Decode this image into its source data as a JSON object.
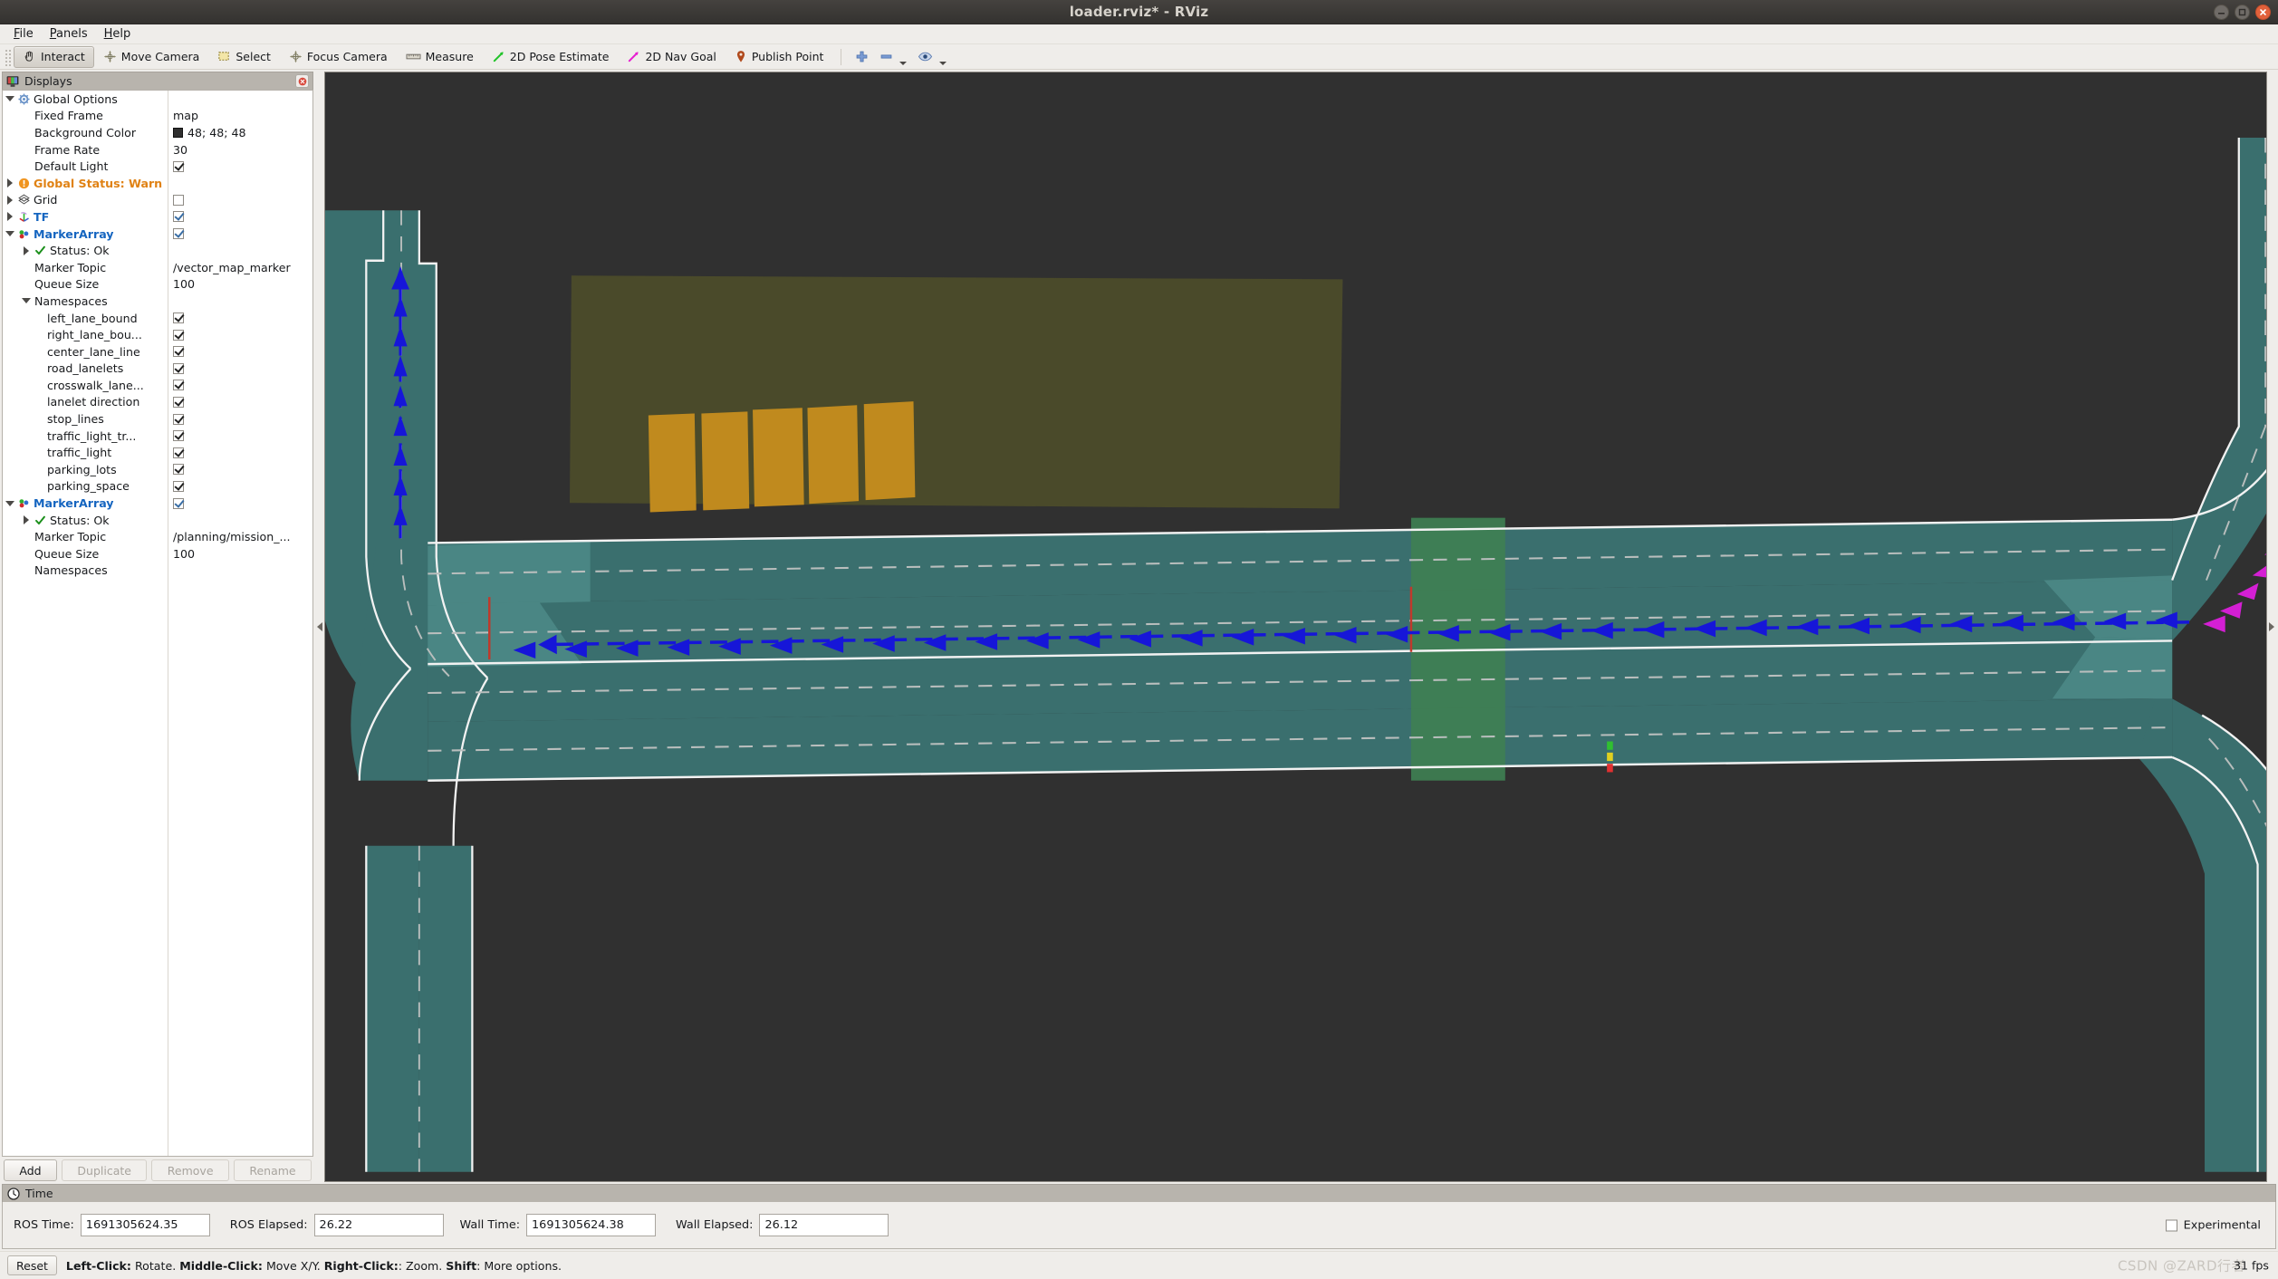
{
  "window": {
    "title": "loader.rviz* - RViz",
    "controls": [
      "minimize",
      "maximize",
      "close"
    ]
  },
  "menubar": {
    "items": [
      {
        "label": "File",
        "mnemonic": "F"
      },
      {
        "label": "Panels",
        "mnemonic": "P"
      },
      {
        "label": "Help",
        "mnemonic": "H"
      }
    ]
  },
  "toolbar": {
    "tools": [
      {
        "label": "Interact",
        "icon": "hand-cursor-icon",
        "active": true
      },
      {
        "label": "Move Camera",
        "icon": "move-camera-icon",
        "active": false
      },
      {
        "label": "Select",
        "icon": "select-rect-icon",
        "active": false
      },
      {
        "label": "Focus Camera",
        "icon": "focus-camera-icon",
        "active": false
      },
      {
        "label": "Measure",
        "icon": "ruler-icon",
        "active": false
      },
      {
        "label": "2D Pose Estimate",
        "icon": "pose-arrow-icon",
        "active": false
      },
      {
        "label": "2D Nav Goal",
        "icon": "nav-goal-arrow-icon",
        "active": false
      },
      {
        "label": "Publish Point",
        "icon": "map-pin-icon",
        "active": false
      }
    ],
    "extra": [
      {
        "icon": "plus-icon",
        "label": ""
      },
      {
        "icon": "minus-icon",
        "label": ""
      },
      {
        "icon": "eye-icon",
        "label": ""
      }
    ]
  },
  "displays_panel": {
    "header": "Displays",
    "close_icon": "close-panel-icon",
    "rows": [
      {
        "level": 0,
        "twisty": "open",
        "icon": "gear-icon",
        "label": "Global Options",
        "style": "plain",
        "value": "",
        "value_type": "none"
      },
      {
        "level": 1,
        "twisty": "none",
        "icon": "none",
        "label": "Fixed Frame",
        "style": "plain",
        "value": "map",
        "value_type": "text"
      },
      {
        "level": 1,
        "twisty": "none",
        "icon": "none",
        "label": "Background Color",
        "style": "plain",
        "value": "48; 48; 48",
        "value_type": "color"
      },
      {
        "level": 1,
        "twisty": "none",
        "icon": "none",
        "label": "Frame Rate",
        "style": "plain",
        "value": "30",
        "value_type": "text"
      },
      {
        "level": 1,
        "twisty": "none",
        "icon": "none",
        "label": "Default Light",
        "style": "plain",
        "value": "",
        "value_type": "checked-dark"
      },
      {
        "level": 0,
        "twisty": "closed",
        "icon": "warn-icon",
        "label": "Global Status: Warn",
        "style": "warn",
        "value": "",
        "value_type": "none"
      },
      {
        "level": 0,
        "twisty": "closed",
        "icon": "grid-icon",
        "label": "Grid",
        "style": "plain",
        "value": "",
        "value_type": "unchecked"
      },
      {
        "level": 0,
        "twisty": "closed",
        "icon": "tf-axes-icon",
        "label": "TF",
        "style": "blue",
        "value": "",
        "value_type": "checked"
      },
      {
        "level": 0,
        "twisty": "open",
        "icon": "marker-array-icon",
        "label": "MarkerArray",
        "style": "blue",
        "value": "",
        "value_type": "checked"
      },
      {
        "level": 1,
        "twisty": "closed",
        "icon": "check-ok-icon",
        "label": "Status: Ok",
        "style": "plain",
        "value": "",
        "value_type": "none"
      },
      {
        "level": 1,
        "twisty": "none",
        "icon": "none",
        "label": "Marker Topic",
        "style": "plain",
        "value": "/vector_map_marker",
        "value_type": "text"
      },
      {
        "level": 1,
        "twisty": "none",
        "icon": "none",
        "label": "Queue Size",
        "style": "plain",
        "value": "100",
        "value_type": "text"
      },
      {
        "level": 1,
        "twisty": "open",
        "icon": "none",
        "label": "Namespaces",
        "style": "plain",
        "value": "",
        "value_type": "none"
      },
      {
        "level": 2,
        "twisty": "none",
        "icon": "none",
        "label": "left_lane_bound",
        "style": "plain",
        "value": "",
        "value_type": "checked-dark"
      },
      {
        "level": 2,
        "twisty": "none",
        "icon": "none",
        "label": "right_lane_bou...",
        "style": "plain",
        "value": "",
        "value_type": "checked-dark"
      },
      {
        "level": 2,
        "twisty": "none",
        "icon": "none",
        "label": "center_lane_line",
        "style": "plain",
        "value": "",
        "value_type": "checked-dark"
      },
      {
        "level": 2,
        "twisty": "none",
        "icon": "none",
        "label": "road_lanelets",
        "style": "plain",
        "value": "",
        "value_type": "checked-dark"
      },
      {
        "level": 2,
        "twisty": "none",
        "icon": "none",
        "label": "crosswalk_lane...",
        "style": "plain",
        "value": "",
        "value_type": "checked-dark"
      },
      {
        "level": 2,
        "twisty": "none",
        "icon": "none",
        "label": "lanelet direction",
        "style": "plain",
        "value": "",
        "value_type": "checked-dark"
      },
      {
        "level": 2,
        "twisty": "none",
        "icon": "none",
        "label": "stop_lines",
        "style": "plain",
        "value": "",
        "value_type": "checked-dark"
      },
      {
        "level": 2,
        "twisty": "none",
        "icon": "none",
        "label": "traffic_light_tr...",
        "style": "plain",
        "value": "",
        "value_type": "checked-dark"
      },
      {
        "level": 2,
        "twisty": "none",
        "icon": "none",
        "label": "traffic_light",
        "style": "plain",
        "value": "",
        "value_type": "checked-dark"
      },
      {
        "level": 2,
        "twisty": "none",
        "icon": "none",
        "label": "parking_lots",
        "style": "plain",
        "value": "",
        "value_type": "checked-dark"
      },
      {
        "level": 2,
        "twisty": "none",
        "icon": "none",
        "label": "parking_space",
        "style": "plain",
        "value": "",
        "value_type": "checked-dark"
      },
      {
        "level": 0,
        "twisty": "open",
        "icon": "marker-array-icon",
        "label": "MarkerArray",
        "style": "blue",
        "value": "",
        "value_type": "checked"
      },
      {
        "level": 1,
        "twisty": "closed",
        "icon": "check-ok-icon",
        "label": "Status: Ok",
        "style": "plain",
        "value": "",
        "value_type": "none"
      },
      {
        "level": 1,
        "twisty": "none",
        "icon": "none",
        "label": "Marker Topic",
        "style": "plain",
        "value": "/planning/mission_...",
        "value_type": "text"
      },
      {
        "level": 1,
        "twisty": "none",
        "icon": "none",
        "label": "Queue Size",
        "style": "plain",
        "value": "100",
        "value_type": "text"
      },
      {
        "level": 1,
        "twisty": "none",
        "icon": "none",
        "label": "Namespaces",
        "style": "plain",
        "value": "",
        "value_type": "none"
      }
    ],
    "buttons": [
      {
        "label": "Add",
        "enabled": true
      },
      {
        "label": "Duplicate",
        "enabled": false
      },
      {
        "label": "Remove",
        "enabled": false
      },
      {
        "label": "Rename",
        "enabled": false
      }
    ]
  },
  "time_panel": {
    "header": "Time",
    "header_icon": "clock-icon",
    "fields": [
      {
        "label": "ROS Time:",
        "value": "1691305624.35"
      },
      {
        "label": "ROS Elapsed:",
        "value": "26.22"
      },
      {
        "label": "Wall Time:",
        "value": "1691305624.38"
      },
      {
        "label": "Wall Elapsed:",
        "value": "26.12"
      }
    ],
    "experimental": {
      "label": "Experimental",
      "checked": false
    }
  },
  "statusbar": {
    "reset_label": "Reset",
    "hint_parts": [
      {
        "text": "Left-Click:",
        "bold": true
      },
      {
        "text": " Rotate. ",
        "bold": false
      },
      {
        "text": "Middle-Click:",
        "bold": true
      },
      {
        "text": " Move X/Y. ",
        "bold": false
      },
      {
        "text": "Right-Click:",
        "bold": true
      },
      {
        "text": ": Zoom. ",
        "bold": false
      },
      {
        "text": "Shift",
        "bold": true
      },
      {
        "text": ": More options.",
        "bold": false
      }
    ],
    "fps": "31 fps",
    "watermark": "CSDN @ZARD行者"
  },
  "viewport": {
    "background_color": "#303030",
    "colors": {
      "road_lanelet": "#3a6f6e",
      "road_lanelet_overlap": "#4d8b88",
      "lane_bound": "#f2f2f2",
      "center_line": "#b9bebd",
      "crosswalk": "#3f7f52",
      "stop_line": "#c0392b",
      "lanelet_direction": "#1616d8",
      "mission_route": "#d41fd4",
      "parking_lot": "#4a4a2a",
      "parking_space": "#c08a1e",
      "traffic_light_red": "#e03030",
      "traffic_light_yellow": "#e0d020",
      "traffic_light_green": "#30c030"
    },
    "elements": [
      "horizontal-main-road",
      "left-intersection",
      "right-intersection",
      "north-branch-road",
      "south-branch-road",
      "parking-lot-area",
      "parking-spaces",
      "crosswalk-area",
      "stop-lines",
      "traffic-light-marker",
      "lanelet-direction-arrows",
      "mission-route-arrows"
    ]
  }
}
